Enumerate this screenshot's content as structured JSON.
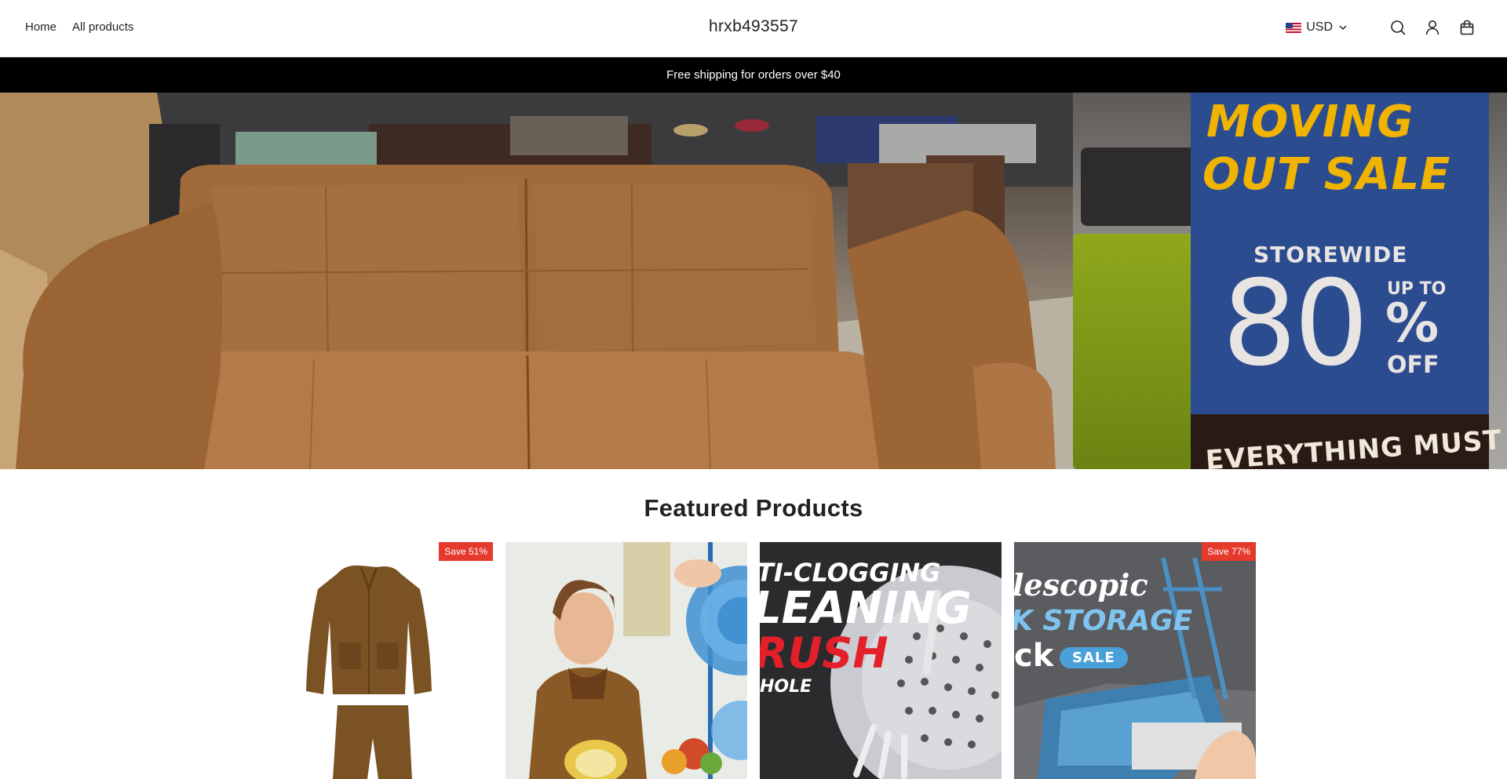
{
  "header": {
    "nav": [
      {
        "label": "Home"
      },
      {
        "label": "All products"
      }
    ],
    "brand": "hrxb493557",
    "currency": {
      "code": "USD",
      "flag": "us-flag-icon"
    },
    "icons": [
      "search-icon",
      "account-icon",
      "cart-icon"
    ]
  },
  "announcement": "Free shipping for orders over $40",
  "hero": {
    "sign": {
      "line1": "MOVING",
      "line2": "OUT SALE",
      "storewide": "STOREWIDE",
      "percent": "80",
      "up_to": "UP TO",
      "percent_sign": "%",
      "off": "OFF",
      "footer": "EVERYTHING MUST GO"
    }
  },
  "featured": {
    "title": "Featured Products",
    "products": [
      {
        "badge": "Save 51%"
      },
      {
        "badge": ""
      },
      {
        "badge": "",
        "image_text": [
          "TI-CLOGGING",
          "LEANING",
          "RUSH",
          "HOLE"
        ]
      },
      {
        "badge": "Save 77%",
        "image_text": [
          "lescopic",
          "K STORAGE",
          "ck",
          "SALE"
        ]
      }
    ]
  },
  "colors": {
    "announcement_bg": "#000000",
    "badge_bg": "#e5392e",
    "sign_blue": "#2b4c8f",
    "sign_yellow": "#f0b400"
  }
}
